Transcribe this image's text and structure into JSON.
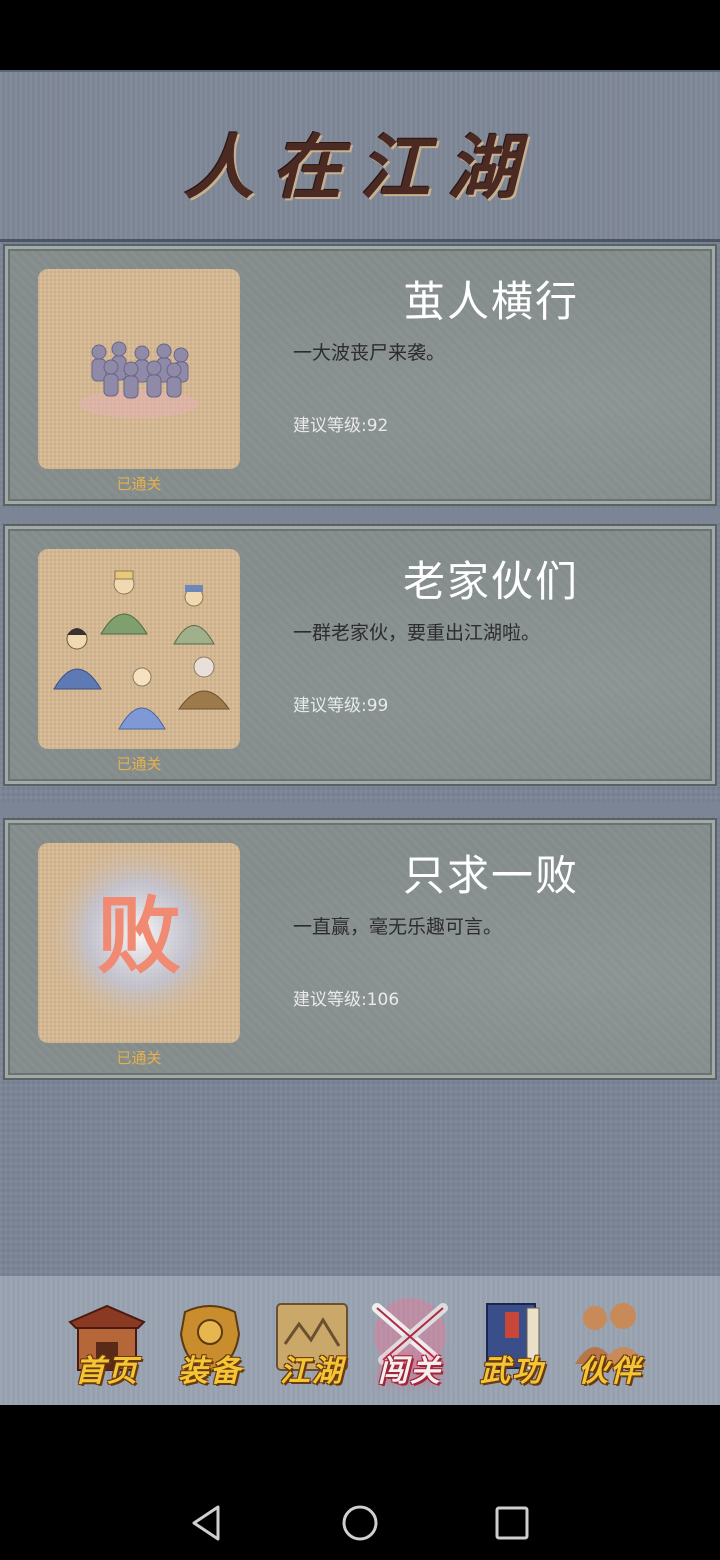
{
  "header": {
    "title": "人在江湖"
  },
  "levels": [
    {
      "title": "茧人横行",
      "description": "一大波丧尸来袭。",
      "requirement": "建议等级:92",
      "status": "已通关",
      "thumb_icon": "zombie-horde-icon"
    },
    {
      "title": "老家伙们",
      "description": "一群老家伙，要重出江湖啦。",
      "requirement": "建议等级:99",
      "status": "已通关",
      "thumb_icon": "elders-group-icon"
    },
    {
      "title": "只求一败",
      "description": "一直赢，毫无乐趣可言。",
      "requirement": "建议等级:106",
      "status": "已通关",
      "thumb_icon": "defeat-character-icon",
      "thumb_text": "败"
    }
  ],
  "nav": {
    "items": [
      {
        "label": "首页",
        "icon": "temple-gate-icon"
      },
      {
        "label": "装备",
        "icon": "armor-icon"
      },
      {
        "label": "江湖",
        "icon": "scroll-map-icon"
      },
      {
        "label": "闯关",
        "icon": "crossed-swords-icon",
        "active": true
      },
      {
        "label": "武功",
        "icon": "martial-book-icon"
      },
      {
        "label": "伙伴",
        "icon": "companions-icon"
      }
    ]
  },
  "colors": {
    "accent_label": "#e7b04b",
    "nav_gold": "#f4c534",
    "active_glow": "#ff5a8a"
  }
}
